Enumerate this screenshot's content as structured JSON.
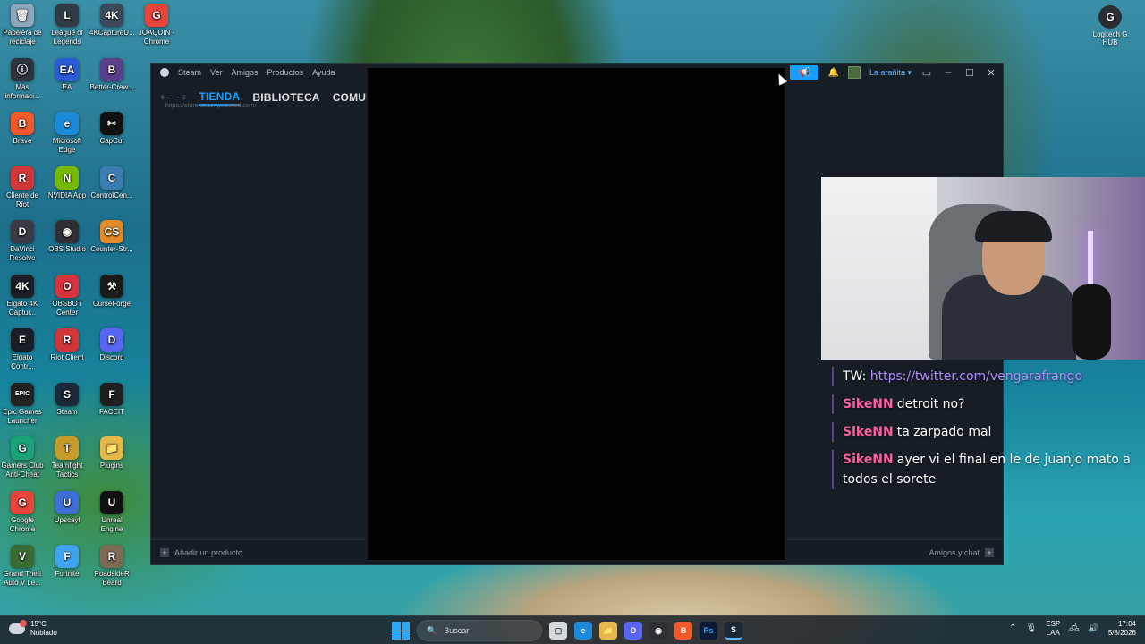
{
  "desktop": {
    "icons": [
      {
        "label": "Papelera de reciclaje",
        "glyph": "🗑",
        "color": "#8fa7bd"
      },
      {
        "label": "League of Legends",
        "glyph": "L",
        "color": "#2f3a44"
      },
      {
        "label": "4KCaptureU...",
        "glyph": "4K",
        "color": "#3b4a5a"
      },
      {
        "label": "JOAQUIN - Chrome",
        "glyph": "G",
        "color": "#e8443a"
      },
      {
        "label": "Más informaci...",
        "glyph": "ⓘ",
        "color": "#2d3440"
      },
      {
        "label": "EA",
        "glyph": "EA",
        "color": "#2b5bd7"
      },
      {
        "label": "Better-Crew...",
        "glyph": "B",
        "color": "#5b3f8c"
      },
      {
        "label": "Brave",
        "glyph": "B",
        "color": "#f0582a"
      },
      {
        "label": "Microsoft Edge",
        "glyph": "e",
        "color": "#1b8ad9"
      },
      {
        "label": "CapCut",
        "glyph": "✂",
        "color": "#111111"
      },
      {
        "label": "Cliente de Riot",
        "glyph": "R",
        "color": "#d13639"
      },
      {
        "label": "NVIDIA App",
        "glyph": "N",
        "color": "#76b900"
      },
      {
        "label": "ControlCen...",
        "glyph": "C",
        "color": "#3a7db0"
      },
      {
        "label": "DaVinci Resolve",
        "glyph": "D",
        "color": "#3a3a44"
      },
      {
        "label": "OBS Studio",
        "glyph": "◉",
        "color": "#302e35"
      },
      {
        "label": "Counter-Str...",
        "glyph": "CS",
        "color": "#e38b25"
      },
      {
        "label": "Elgato 4K Captur...",
        "glyph": "4K",
        "color": "#1b1e24"
      },
      {
        "label": "OBSBOT Center",
        "glyph": "O",
        "color": "#d8323c"
      },
      {
        "label": "CurseForge",
        "glyph": "⚒",
        "color": "#1b1b1b"
      },
      {
        "label": "Elgato Contr...",
        "glyph": "E",
        "color": "#1b1e24"
      },
      {
        "label": "Riot Client",
        "glyph": "R",
        "color": "#d13639"
      },
      {
        "label": "Discord",
        "glyph": "D",
        "color": "#5865f2"
      },
      {
        "label": "Epic Games Launcher",
        "glyph": "EPIC",
        "color": "#222222"
      },
      {
        "label": "Steam",
        "glyph": "S",
        "color": "#1b2838"
      },
      {
        "label": "FACEIT",
        "glyph": "F",
        "color": "#1f1f1f"
      },
      {
        "label": "Gamers Club Anti-Cheat",
        "glyph": "G",
        "color": "#1aa37a"
      },
      {
        "label": "Teamfight Tactics",
        "glyph": "T",
        "color": "#c69a2b"
      },
      {
        "label": "Plugins",
        "glyph": "📁",
        "color": "#e6b84c"
      },
      {
        "label": "Google Chrome",
        "glyph": "G",
        "color": "#e8443a"
      },
      {
        "label": "Upscayl",
        "glyph": "U",
        "color": "#3e6ed9"
      },
      {
        "label": "Unreal Engine",
        "glyph": "U",
        "color": "#111111"
      },
      {
        "label": "Grand Theft Auto V Le...",
        "glyph": "V",
        "color": "#3a6b33"
      },
      {
        "label": "Fortnite",
        "glyph": "F",
        "color": "#3fa4f0"
      },
      {
        "label": "RoadsideR Beard",
        "glyph": "R",
        "color": "#7d6a55"
      }
    ],
    "logitech": {
      "label": "Logitech G HUB",
      "glyph": "G"
    }
  },
  "steam": {
    "menu": [
      "Steam",
      "Ver",
      "Amigos",
      "Productos",
      "Ayuda"
    ],
    "tabs": [
      "TIENDA",
      "BIBLIOTECA",
      "COMUNI"
    ],
    "url": "https://store.steampowered.com/",
    "user_name": "La arañita",
    "add_product": "Añadir un producto",
    "friends_chat": "Amigos y chat"
  },
  "chat": {
    "lines": [
      {
        "user": "",
        "prefix": "TW: ",
        "text": "https://twitter.com/vengarafrango"
      },
      {
        "user": "SikeNN",
        "prefix": "",
        "text": "detroit no?"
      },
      {
        "user": "SikeNN",
        "prefix": "",
        "text": "ta zarpado mal"
      },
      {
        "user": "SikeNN",
        "prefix": "",
        "text": "ayer vi el final en le de juanjo mato a todos el sorete"
      }
    ]
  },
  "taskbar": {
    "weather_temp": "15°C",
    "weather_desc": "Nublado",
    "search_placeholder": "Buscar",
    "lang_top": "ESP",
    "lang_bottom": "LAA",
    "time": "17:04",
    "date": "5/8/2026"
  },
  "colors": {
    "steam_accent": "#1a9fff",
    "chat_user": "#ff5fa2",
    "chat_link": "#b48bff"
  }
}
